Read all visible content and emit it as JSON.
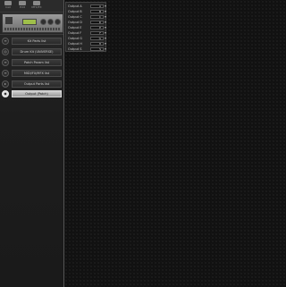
{
  "sidebar": {
    "top_icons": [
      {
        "label": "Inst",
        "icon": "instrument-icon"
      },
      {
        "label": "Edit",
        "icon": "edit-icon"
      },
      {
        "label": "MFX/FX",
        "icon": "effects-icon"
      }
    ],
    "items": [
      {
        "label": "Kit Parts list",
        "icon": "parts-icon"
      },
      {
        "label": "Drum Kit (UNIVERSE)",
        "icon": "drumkit-icon"
      },
      {
        "label": "Patch Param list",
        "icon": "patch-icon"
      },
      {
        "label": "MIDI/FX/MFX list",
        "icon": "midi-icon"
      },
      {
        "label": "Output Parts list",
        "icon": "output-list-icon"
      },
      {
        "label": "Output (Patch)",
        "icon": "output-icon"
      }
    ],
    "selected_index": 5
  },
  "outputs_panel": {
    "rows": [
      {
        "name": "Output A",
        "value": "A"
      },
      {
        "name": "Output B",
        "value": "B"
      },
      {
        "name": "Output C",
        "value": "C"
      },
      {
        "name": "Output D",
        "value": "D"
      },
      {
        "name": "Output E",
        "value": "E"
      },
      {
        "name": "Output F",
        "value": "F"
      },
      {
        "name": "Output G",
        "value": "G"
      },
      {
        "name": "Output H",
        "value": "H"
      },
      {
        "name": "Output S",
        "value": "S"
      }
    ]
  }
}
